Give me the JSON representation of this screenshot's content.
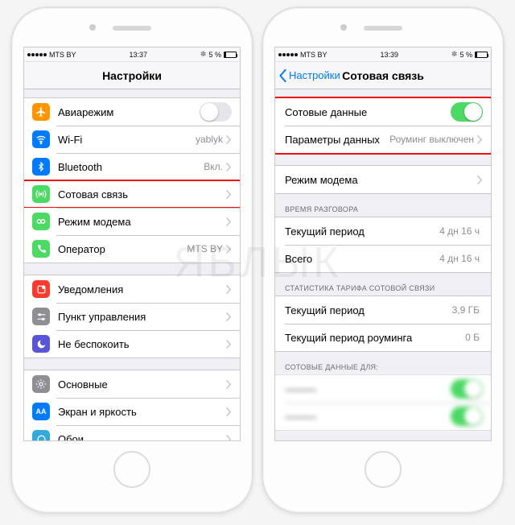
{
  "status": {
    "carrier": "MTS BY",
    "time_left": "13:37",
    "time_right": "13:39",
    "battery": "5 %"
  },
  "left": {
    "title": "Настройки",
    "groups": [
      {
        "rows": [
          {
            "icon": "airplane-icon",
            "bg": "bg-orange",
            "label": "Авиарежим",
            "control": "toggle",
            "on": false
          },
          {
            "icon": "wifi-icon",
            "bg": "bg-blue",
            "label": "Wi-Fi",
            "value": "yablyk",
            "control": "link"
          },
          {
            "icon": "bluetooth-icon",
            "bg": "bg-blue",
            "label": "Bluetooth",
            "value": "Вкл.",
            "control": "link"
          },
          {
            "icon": "cellular-icon",
            "bg": "bg-green",
            "label": "Сотовая связь",
            "control": "link",
            "highlight": true
          },
          {
            "icon": "hotspot-icon",
            "bg": "bg-green",
            "label": "Режим модема",
            "control": "link"
          },
          {
            "icon": "phone-icon",
            "bg": "bg-green",
            "label": "Оператор",
            "value": "MTS BY",
            "control": "link"
          }
        ]
      },
      {
        "rows": [
          {
            "icon": "notification-icon",
            "bg": "bg-red",
            "label": "Уведомления",
            "control": "link"
          },
          {
            "icon": "control-center-icon",
            "bg": "bg-gray",
            "label": "Пункт управления",
            "control": "link"
          },
          {
            "icon": "dnd-icon",
            "bg": "bg-purple",
            "label": "Не беспокоить",
            "control": "link"
          }
        ]
      },
      {
        "rows": [
          {
            "icon": "general-icon",
            "bg": "bg-gray",
            "label": "Основные",
            "control": "link"
          },
          {
            "icon": "display-icon",
            "bg": "bg-blue",
            "label": "Экран и яркость",
            "control": "link"
          },
          {
            "icon": "wallpaper-icon",
            "bg": "bg-bluel",
            "label": "Обои",
            "control": "link"
          }
        ]
      }
    ]
  },
  "right": {
    "back": "Настройки",
    "title": "Сотовая связь",
    "group1": [
      {
        "label": "Сотовые данные",
        "control": "toggle",
        "on": true
      },
      {
        "label": "Параметры данных",
        "value": "Роуминг выключен",
        "control": "link"
      }
    ],
    "group2": [
      {
        "label": "Режим модема",
        "control": "link"
      }
    ],
    "talk_header": "ВРЕМЯ РАЗГОВОРА",
    "talk": [
      {
        "label": "Текущий период",
        "value": "4 дн 16 ч"
      },
      {
        "label": "Всего",
        "value": "4 дн 16 ч"
      }
    ],
    "stats_header": "СТАТИСТИКА ТАРИФА СОТОВОЙ СВЯЗИ",
    "stats": [
      {
        "label": "Текущий период",
        "value": "3,9 ГБ"
      },
      {
        "label": "Текущий период роуминга",
        "value": "0 Б"
      }
    ],
    "apps_header": "СОТОВЫЕ ДАННЫЕ ДЛЯ:"
  },
  "watermark": "ЯБЛЫК"
}
